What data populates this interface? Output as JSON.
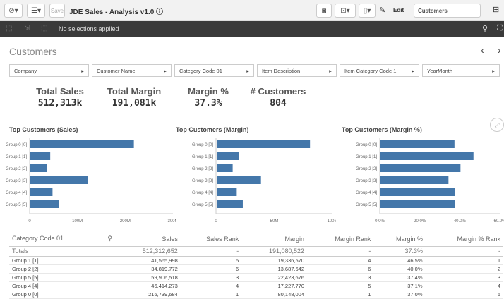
{
  "toolbar": {
    "save_label": "Save",
    "app_title": "JDE Sales - Analysis v1.0",
    "edit_label": "Edit",
    "sheet_name": "Customers"
  },
  "selections": {
    "status": "No selections applied"
  },
  "sheet": {
    "title": "Customers"
  },
  "filters": [
    "Company",
    "Customer Name",
    "Category Code 01",
    "Item Description",
    "Item Category Code 1",
    "YearMonth"
  ],
  "kpis": [
    {
      "label": "Total Sales",
      "value": "512,313k"
    },
    {
      "label": "Total Margin",
      "value": "191,081k"
    },
    {
      "label": "Margin %",
      "value": "37.3%"
    },
    {
      "label": "# Customers",
      "value": "804"
    }
  ],
  "charts": {
    "sales_title": "Top Customers (Sales)",
    "margin_title": "Top Customers (Margin)",
    "pct_title": "Top Customers (Margin %)",
    "bar_color": "#4477aa"
  },
  "chart_data": [
    {
      "type": "bar",
      "orientation": "horizontal",
      "title": "Top Customers (Sales)",
      "categories": [
        "Group 0 [0]",
        "Group 1 [1]",
        "Group 2 [2]",
        "Group 3 [3]",
        "Group 4 [4]",
        "Group 5 [5]"
      ],
      "values": [
        216.7,
        41.6,
        34.8,
        120,
        46.4,
        59.9
      ],
      "xlim": [
        0,
        300
      ],
      "ticks": [
        "0",
        "100M",
        "200M",
        "300M"
      ]
    },
    {
      "type": "bar",
      "orientation": "horizontal",
      "title": "Top Customers (Margin)",
      "categories": [
        "Group 0 [0]",
        "Group 1 [1]",
        "Group 2 [2]",
        "Group 3 [3]",
        "Group 4 [4]",
        "Group 5 [5]"
      ],
      "values": [
        80.1,
        19.3,
        13.7,
        38,
        17.2,
        22.4
      ],
      "xlim": [
        0,
        100
      ],
      "ticks": [
        "0",
        "50M",
        "100M"
      ]
    },
    {
      "type": "bar",
      "orientation": "horizontal",
      "title": "Top Customers (Margin %)",
      "categories": [
        "Group 0 [0]",
        "Group 1 [1]",
        "Group 2 [2]",
        "Group 3 [3]",
        "Group 4 [4]",
        "Group 5 [5]"
      ],
      "values": [
        37.0,
        46.5,
        40.0,
        34,
        37.1,
        37.4
      ],
      "xlim": [
        0,
        60
      ],
      "ticks": [
        "0.0%",
        "20.0%",
        "40.0%",
        "60.0%"
      ]
    }
  ],
  "table": {
    "headers": [
      "Category Code 01",
      "Sales",
      "Sales Rank",
      "Margin",
      "Margin Rank",
      "Margin %",
      "Margin % Rank"
    ],
    "totals": [
      "Totals",
      "512,312,652",
      "-",
      "191,080,522",
      "-",
      "37.3%",
      "-"
    ],
    "rows": [
      [
        "Group 1 [1]",
        "41,565,998",
        "5",
        "19,336,570",
        "4",
        "46.5%",
        "1"
      ],
      [
        "Group 2 [2]",
        "34,819,772",
        "6",
        "13,687,642",
        "6",
        "40.0%",
        "2"
      ],
      [
        "Group 5 [5]",
        "59,906,518",
        "3",
        "22,423,676",
        "3",
        "37.4%",
        "3"
      ],
      [
        "Group 4 [4]",
        "46,414,273",
        "4",
        "17,227,770",
        "5",
        "37.1%",
        "4"
      ],
      [
        "Group 0 [0]",
        "216,739,684",
        "1",
        "80,148,004",
        "1",
        "37.0%",
        "5"
      ]
    ]
  }
}
